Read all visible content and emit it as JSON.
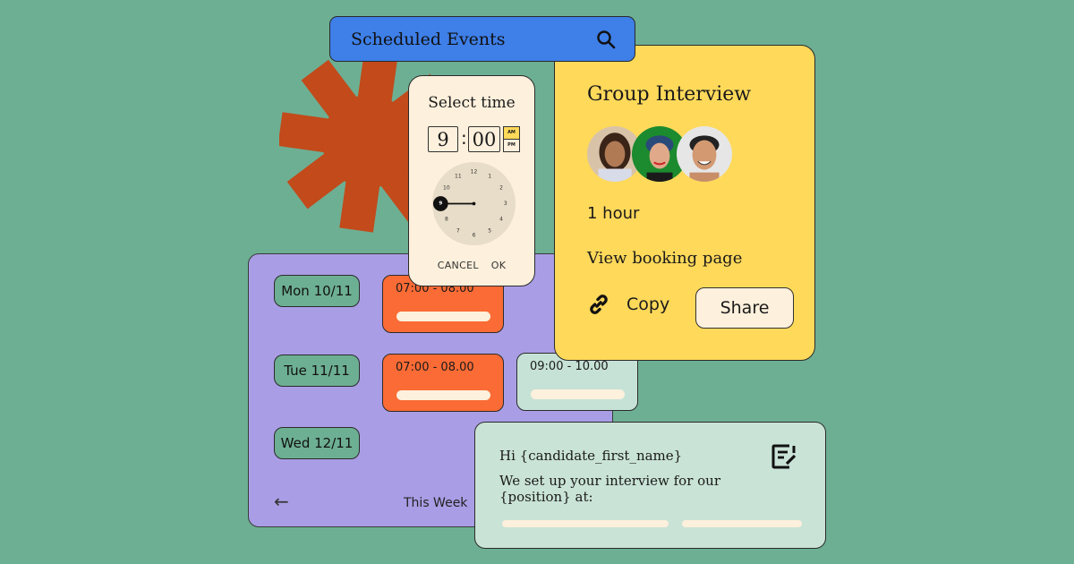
{
  "colors": {
    "background": "#6daf93",
    "search_bar": "#3e7fe8",
    "starburst": "#c24a1b",
    "calendar": "#a99ee5",
    "slot_orange": "#fb6b35",
    "slot_mint": "#c6e2d6",
    "card_yellow": "#ffd95a",
    "cream": "#fdf0dc",
    "email_card": "#c9e3d6"
  },
  "search": {
    "title": "Scheduled Events",
    "icon": "search-icon"
  },
  "time_picker": {
    "title": "Select time",
    "hour": "9",
    "separator": ":",
    "minute": "00",
    "am_label": "AM",
    "pm_label": "PM",
    "selected_period": "AM",
    "clock_numbers": [
      "12",
      "1",
      "2",
      "3",
      "4",
      "5",
      "6",
      "7",
      "8",
      "9",
      "10",
      "11"
    ],
    "selected_hour": 9,
    "cancel_label": "CANCEL",
    "ok_label": "OK"
  },
  "group_interview": {
    "title": "Group Interview",
    "attendees": [
      "attendee-1",
      "attendee-2",
      "attendee-3"
    ],
    "duration": "1 hour",
    "view_link": "View booking page",
    "copy_label": "Copy",
    "copy_icon": "link-icon",
    "share_label": "Share"
  },
  "calendar": {
    "days": [
      {
        "label": "Mon 10/11",
        "slots": [
          "07:00 - 08.00"
        ]
      },
      {
        "label": "Tue 11/11",
        "slots": [
          "07:00 - 08.00",
          "09:00 - 10.00"
        ]
      },
      {
        "label": "Wed 12/11",
        "slots": []
      }
    ],
    "back_icon": "arrow-left-icon",
    "week_label": "This Week"
  },
  "email": {
    "greeting": "Hi {candidate_first_name}",
    "body": "We set up your interview for our {position} at:",
    "edit_icon": "edit-note-icon"
  }
}
